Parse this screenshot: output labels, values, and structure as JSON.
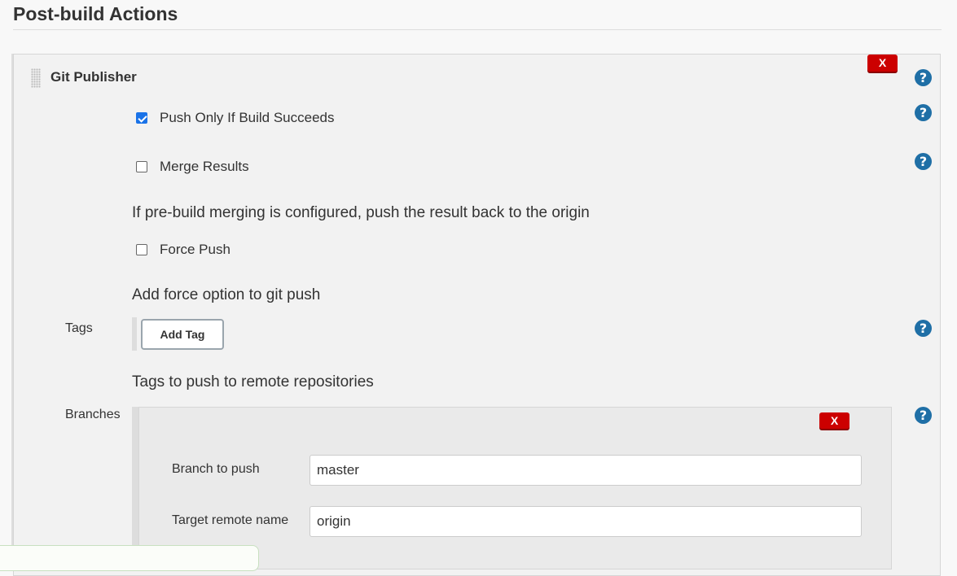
{
  "section": {
    "title": "Post-build Actions"
  },
  "publisher": {
    "title": "Git Publisher",
    "delete_label": "X",
    "help_label": "?",
    "push_only": {
      "label": "Push Only If Build Succeeds",
      "checked": true
    },
    "merge_results": {
      "label": "Merge Results",
      "checked": false
    },
    "merge_desc": "If pre-build merging is configured, push the result back to the origin",
    "force_push": {
      "label": "Force Push",
      "checked": false
    },
    "force_desc": "Add force option to git push",
    "tags": {
      "label": "Tags",
      "add_button": "Add Tag",
      "desc": "Tags to push to remote repositories"
    },
    "branches": {
      "label": "Branches",
      "delete_label": "X",
      "branch_to_push_label": "Branch to push",
      "branch_to_push_value": "master",
      "target_remote_label": "Target remote name",
      "target_remote_value": "origin"
    }
  },
  "colors": {
    "delete": "#cc0000",
    "help": "#1f6fa6",
    "checkbox": "#1a73e8"
  }
}
